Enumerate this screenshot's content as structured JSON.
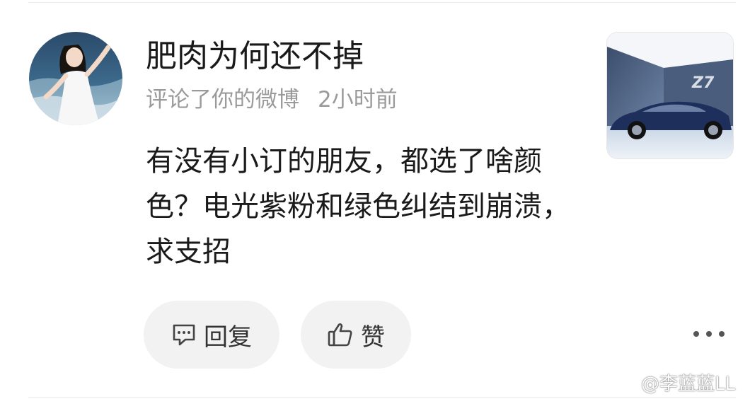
{
  "comment": {
    "user_name": "肥肉为何还不掉",
    "action": "评论了你的微博",
    "time": "2小时前",
    "text": "有没有小订的朋友，都选了啥颜色？电光紫粉和绿色纠结到崩溃，求支招"
  },
  "actions": {
    "reply_label": "回复",
    "like_label": "赞"
  },
  "thumbnail": {
    "icon": "car-photo",
    "caption": "Z7"
  },
  "watermark": {
    "text": "@李蓝蓝LL"
  },
  "colors": {
    "text_primary": "#1a1a1a",
    "text_secondary": "#9a9a9a",
    "button_bg": "#f2f2f2"
  }
}
